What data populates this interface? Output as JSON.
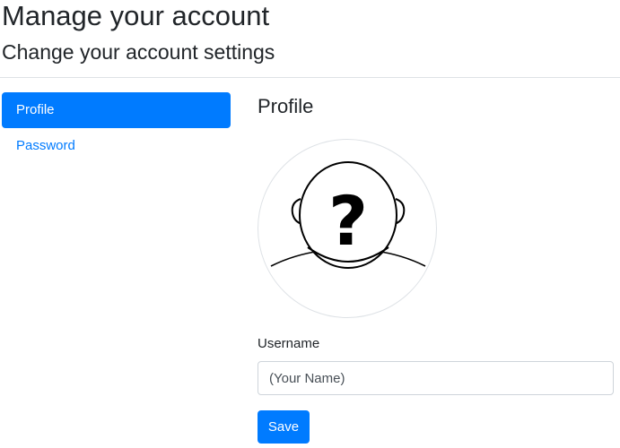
{
  "header": {
    "title": "Manage your account",
    "subtitle": "Change your account settings"
  },
  "nav": {
    "items": [
      {
        "label": "Profile",
        "active": true
      },
      {
        "label": "Password",
        "active": false
      }
    ]
  },
  "main": {
    "section_title": "Profile",
    "avatar": {
      "icon": "unknown-user-silhouette-icon"
    },
    "username": {
      "label": "Username",
      "placeholder": "(Your Name)",
      "value": ""
    },
    "save_label": "Save"
  },
  "colors": {
    "accent": "#007bff",
    "text": "#212529",
    "border": "#dee2e6"
  }
}
